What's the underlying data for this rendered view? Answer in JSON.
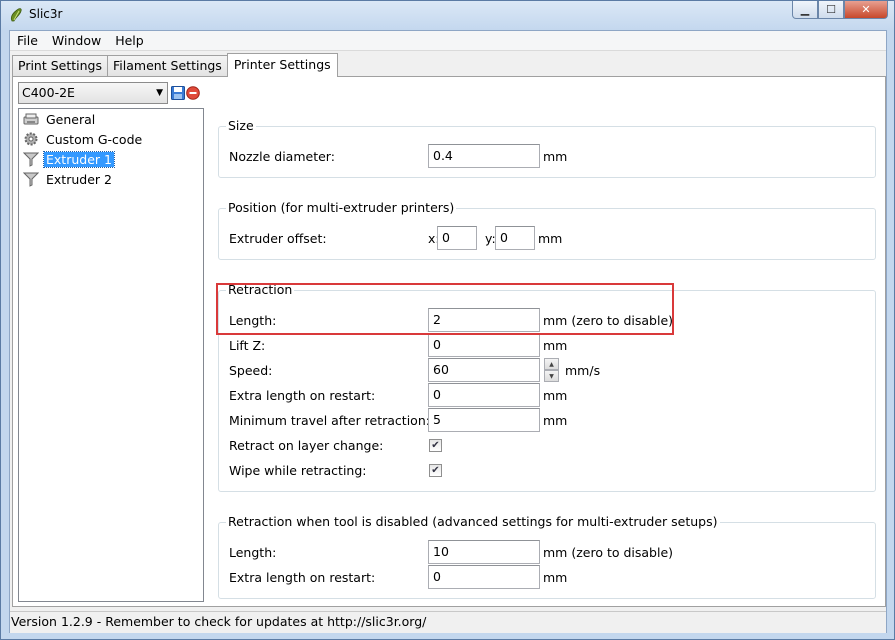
{
  "window": {
    "title": "Slic3r",
    "controls": {
      "minimize": "▁",
      "maximize": "☐",
      "close": "✕"
    }
  },
  "menu": [
    "File",
    "Window",
    "Help"
  ],
  "tabs": [
    "Print Settings",
    "Filament Settings",
    "Printer Settings"
  ],
  "preset": {
    "value": "C400-2E"
  },
  "tree": [
    {
      "label": "General",
      "icon": "printer-icon"
    },
    {
      "label": "Custom G-code",
      "icon": "cog-icon"
    },
    {
      "label": "Extruder 1",
      "icon": "funnel-icon",
      "selected": true
    },
    {
      "label": "Extruder 2",
      "icon": "funnel-icon"
    }
  ],
  "size": {
    "title": "Size",
    "nozzle_label": "Nozzle diameter:",
    "nozzle_value": "0.4",
    "nozzle_unit": "mm"
  },
  "position": {
    "title": "Position (for multi-extruder printers)",
    "offset_label": "Extruder offset:",
    "x_label": "x:",
    "x_value": "0",
    "y_label": "y:",
    "y_value": "0",
    "unit": "mm"
  },
  "retraction": {
    "title": "Retraction",
    "length_label": "Length:",
    "length_value": "2",
    "length_unit": "mm (zero to disable)",
    "liftz_label": "Lift Z:",
    "liftz_value": "0",
    "liftz_unit": "mm",
    "speed_label": "Speed:",
    "speed_value": "60",
    "speed_unit": "mm/s",
    "extra_label": "Extra length on restart:",
    "extra_value": "0",
    "extra_unit": "mm",
    "travel_label": "Minimum travel after retraction:",
    "travel_value": "5",
    "travel_unit": "mm",
    "layer_change_label": "Retract on layer change:",
    "layer_change_checked": true,
    "wipe_label": "Wipe while retracting:",
    "wipe_checked": true
  },
  "retraction_disabled": {
    "title": "Retraction when tool is disabled (advanced settings for multi-extruder setups)",
    "length_label": "Length:",
    "length_value": "10",
    "length_unit": "mm (zero to disable)",
    "extra_label": "Extra length on restart:",
    "extra_value": "0",
    "extra_unit": "mm"
  },
  "status": "Version 1.2.9 - Remember to check for updates at http://slic3r.org/",
  "colors": {
    "highlight": "#d9393a",
    "selection": "#3399ff"
  }
}
